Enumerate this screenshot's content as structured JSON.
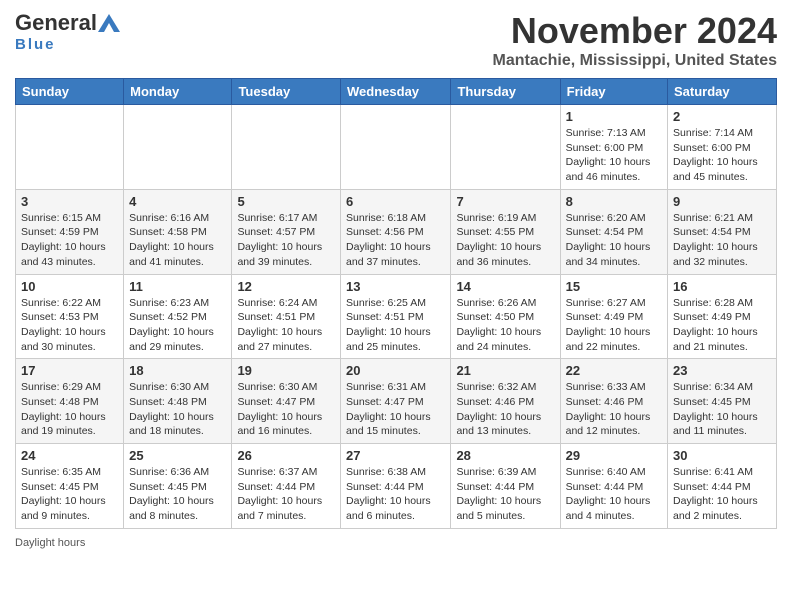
{
  "header": {
    "logo_general": "General",
    "logo_blue": "Blue",
    "month_title": "November 2024",
    "location": "Mantachie, Mississippi, United States"
  },
  "weekdays": [
    "Sunday",
    "Monday",
    "Tuesday",
    "Wednesday",
    "Thursday",
    "Friday",
    "Saturday"
  ],
  "weeks": [
    [
      {
        "day": "",
        "info": ""
      },
      {
        "day": "",
        "info": ""
      },
      {
        "day": "",
        "info": ""
      },
      {
        "day": "",
        "info": ""
      },
      {
        "day": "",
        "info": ""
      },
      {
        "day": "1",
        "sunrise": "Sunrise: 7:13 AM",
        "sunset": "Sunset: 6:00 PM",
        "daylight": "Daylight: 10 hours and 46 minutes."
      },
      {
        "day": "2",
        "sunrise": "Sunrise: 7:14 AM",
        "sunset": "Sunset: 6:00 PM",
        "daylight": "Daylight: 10 hours and 45 minutes."
      }
    ],
    [
      {
        "day": "3",
        "sunrise": "Sunrise: 6:15 AM",
        "sunset": "Sunset: 4:59 PM",
        "daylight": "Daylight: 10 hours and 43 minutes."
      },
      {
        "day": "4",
        "sunrise": "Sunrise: 6:16 AM",
        "sunset": "Sunset: 4:58 PM",
        "daylight": "Daylight: 10 hours and 41 minutes."
      },
      {
        "day": "5",
        "sunrise": "Sunrise: 6:17 AM",
        "sunset": "Sunset: 4:57 PM",
        "daylight": "Daylight: 10 hours and 39 minutes."
      },
      {
        "day": "6",
        "sunrise": "Sunrise: 6:18 AM",
        "sunset": "Sunset: 4:56 PM",
        "daylight": "Daylight: 10 hours and 37 minutes."
      },
      {
        "day": "7",
        "sunrise": "Sunrise: 6:19 AM",
        "sunset": "Sunset: 4:55 PM",
        "daylight": "Daylight: 10 hours and 36 minutes."
      },
      {
        "day": "8",
        "sunrise": "Sunrise: 6:20 AM",
        "sunset": "Sunset: 4:54 PM",
        "daylight": "Daylight: 10 hours and 34 minutes."
      },
      {
        "day": "9",
        "sunrise": "Sunrise: 6:21 AM",
        "sunset": "Sunset: 4:54 PM",
        "daylight": "Daylight: 10 hours and 32 minutes."
      }
    ],
    [
      {
        "day": "10",
        "sunrise": "Sunrise: 6:22 AM",
        "sunset": "Sunset: 4:53 PM",
        "daylight": "Daylight: 10 hours and 30 minutes."
      },
      {
        "day": "11",
        "sunrise": "Sunrise: 6:23 AM",
        "sunset": "Sunset: 4:52 PM",
        "daylight": "Daylight: 10 hours and 29 minutes."
      },
      {
        "day": "12",
        "sunrise": "Sunrise: 6:24 AM",
        "sunset": "Sunset: 4:51 PM",
        "daylight": "Daylight: 10 hours and 27 minutes."
      },
      {
        "day": "13",
        "sunrise": "Sunrise: 6:25 AM",
        "sunset": "Sunset: 4:51 PM",
        "daylight": "Daylight: 10 hours and 25 minutes."
      },
      {
        "day": "14",
        "sunrise": "Sunrise: 6:26 AM",
        "sunset": "Sunset: 4:50 PM",
        "daylight": "Daylight: 10 hours and 24 minutes."
      },
      {
        "day": "15",
        "sunrise": "Sunrise: 6:27 AM",
        "sunset": "Sunset: 4:49 PM",
        "daylight": "Daylight: 10 hours and 22 minutes."
      },
      {
        "day": "16",
        "sunrise": "Sunrise: 6:28 AM",
        "sunset": "Sunset: 4:49 PM",
        "daylight": "Daylight: 10 hours and 21 minutes."
      }
    ],
    [
      {
        "day": "17",
        "sunrise": "Sunrise: 6:29 AM",
        "sunset": "Sunset: 4:48 PM",
        "daylight": "Daylight: 10 hours and 19 minutes."
      },
      {
        "day": "18",
        "sunrise": "Sunrise: 6:30 AM",
        "sunset": "Sunset: 4:48 PM",
        "daylight": "Daylight: 10 hours and 18 minutes."
      },
      {
        "day": "19",
        "sunrise": "Sunrise: 6:30 AM",
        "sunset": "Sunset: 4:47 PM",
        "daylight": "Daylight: 10 hours and 16 minutes."
      },
      {
        "day": "20",
        "sunrise": "Sunrise: 6:31 AM",
        "sunset": "Sunset: 4:47 PM",
        "daylight": "Daylight: 10 hours and 15 minutes."
      },
      {
        "day": "21",
        "sunrise": "Sunrise: 6:32 AM",
        "sunset": "Sunset: 4:46 PM",
        "daylight": "Daylight: 10 hours and 13 minutes."
      },
      {
        "day": "22",
        "sunrise": "Sunrise: 6:33 AM",
        "sunset": "Sunset: 4:46 PM",
        "daylight": "Daylight: 10 hours and 12 minutes."
      },
      {
        "day": "23",
        "sunrise": "Sunrise: 6:34 AM",
        "sunset": "Sunset: 4:45 PM",
        "daylight": "Daylight: 10 hours and 11 minutes."
      }
    ],
    [
      {
        "day": "24",
        "sunrise": "Sunrise: 6:35 AM",
        "sunset": "Sunset: 4:45 PM",
        "daylight": "Daylight: 10 hours and 9 minutes."
      },
      {
        "day": "25",
        "sunrise": "Sunrise: 6:36 AM",
        "sunset": "Sunset: 4:45 PM",
        "daylight": "Daylight: 10 hours and 8 minutes."
      },
      {
        "day": "26",
        "sunrise": "Sunrise: 6:37 AM",
        "sunset": "Sunset: 4:44 PM",
        "daylight": "Daylight: 10 hours and 7 minutes."
      },
      {
        "day": "27",
        "sunrise": "Sunrise: 6:38 AM",
        "sunset": "Sunset: 4:44 PM",
        "daylight": "Daylight: 10 hours and 6 minutes."
      },
      {
        "day": "28",
        "sunrise": "Sunrise: 6:39 AM",
        "sunset": "Sunset: 4:44 PM",
        "daylight": "Daylight: 10 hours and 5 minutes."
      },
      {
        "day": "29",
        "sunrise": "Sunrise: 6:40 AM",
        "sunset": "Sunset: 4:44 PM",
        "daylight": "Daylight: 10 hours and 4 minutes."
      },
      {
        "day": "30",
        "sunrise": "Sunrise: 6:41 AM",
        "sunset": "Sunset: 4:44 PM",
        "daylight": "Daylight: 10 hours and 2 minutes."
      }
    ]
  ],
  "footer": {
    "daylight_hours_label": "Daylight hours"
  }
}
